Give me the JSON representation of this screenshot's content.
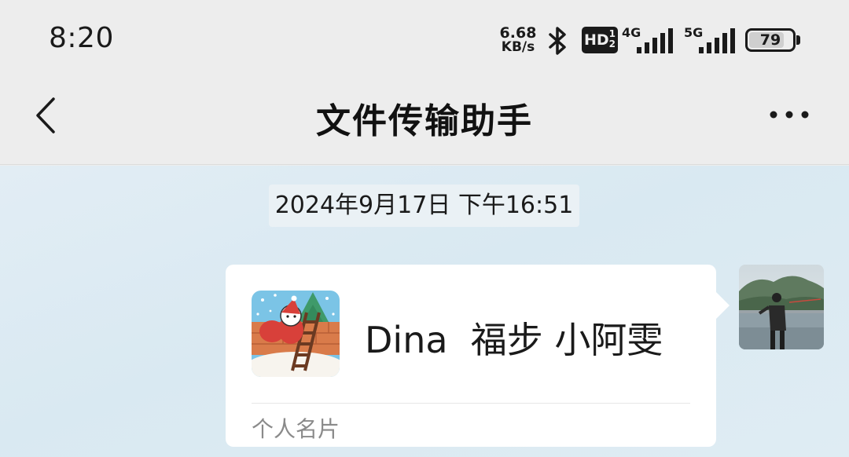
{
  "status_bar": {
    "time": "8:20",
    "net_speed_value": "6.68",
    "net_speed_unit": "KB/s",
    "icons": [
      "bluetooth-icon",
      "hd-icon",
      "signal-4g-icon",
      "signal-5g-icon",
      "battery-icon"
    ],
    "hd_label": "HD",
    "hd_sup": "1",
    "hd_sub": "2",
    "sig1_label": "4G",
    "sig2_label": "5G",
    "battery_level": "79"
  },
  "nav": {
    "title": "文件传输助手",
    "back_icon": "chevron-left-icon",
    "more_icon": "more-dots-icon"
  },
  "chat": {
    "timestamp": "2024年9月17日 下午16:51",
    "messages": [
      {
        "type": "contact-card",
        "name": "Dina  福步 小阿雯",
        "card_type": "个人名片",
        "sender": "self"
      }
    ]
  },
  "colors": {
    "status_bg": "#ededed",
    "chat_bg": "#dceaf2",
    "card_bg": "#ffffff",
    "text_primary": "#1a1a1a",
    "text_secondary": "#8a8a8a"
  }
}
